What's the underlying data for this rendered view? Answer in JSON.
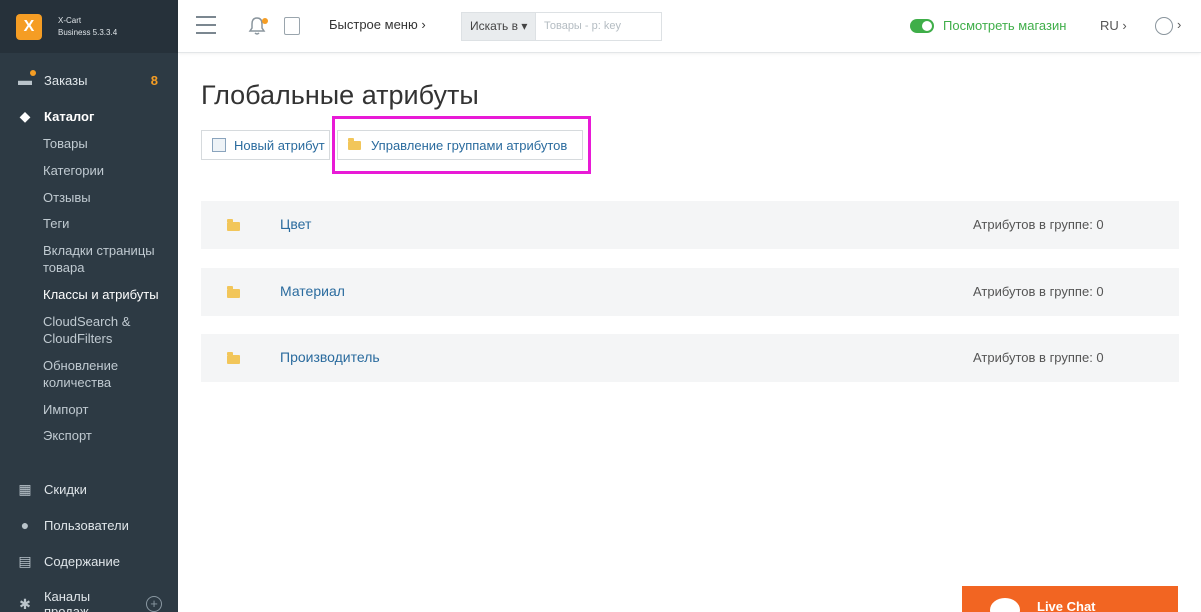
{
  "brand": {
    "logo_glyph": "X",
    "line1": "X-Cart",
    "line2": "Business 5.3.3.4"
  },
  "sidebar": {
    "orders": {
      "label": "Заказы",
      "badge": "8"
    },
    "catalog": {
      "label": "Каталог"
    },
    "catalog_items": [
      "Товары",
      "Категории",
      "Отзывы",
      "Теги",
      "Вкладки страницы товара",
      "Классы и атрибуты",
      "CloudSearch & CloudFilters",
      "Обновление количества",
      "Импорт",
      "Экспорт"
    ],
    "discounts": {
      "label": "Скидки"
    },
    "users": {
      "label": "Пользователи"
    },
    "content": {
      "label": "Содержание"
    },
    "sales_channels": {
      "label": "Каналы продаж",
      "plus": "+"
    }
  },
  "header": {
    "quick_menu": "Быстрое меню ›",
    "search_select": "Искать в ▾",
    "search_placeholder": "Товары - p: key",
    "view_store": "Посмотреть магазин",
    "lang": "RU ›",
    "user_chevron": "›"
  },
  "main": {
    "title": "Глобальные атрибуты",
    "new_attribute_label": "Новый атрибут",
    "manage_groups_label": "Управление группами атрибутов",
    "groups": [
      {
        "name": "Цвет",
        "count_label": "Атрибутов в группе: 0"
      },
      {
        "name": "Материал",
        "count_label": "Атрибутов в группе: 0"
      },
      {
        "name": "Производитель",
        "count_label": "Атрибутов в группе: 0"
      }
    ]
  },
  "live_chat": {
    "label": "Live Chat"
  },
  "colors": {
    "accent_orange": "#f59d24",
    "highlight_magenta": "#e81ad6",
    "store_green": "#3fae49",
    "sidebar_bg": "#2d3a44",
    "live_chat_bg": "#f26522"
  }
}
